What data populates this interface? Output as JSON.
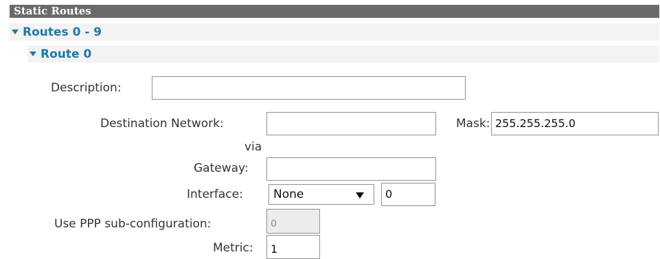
{
  "section": {
    "title": "Static Routes"
  },
  "routes_group": {
    "label": "Routes 0 - 9"
  },
  "route": {
    "label": "Route 0",
    "description": {
      "label": "Description:",
      "value": ""
    },
    "destination": {
      "label": "Destination Network:",
      "value": ""
    },
    "mask": {
      "label": "Mask:",
      "value": "255.255.255.0"
    },
    "via": "via",
    "gateway": {
      "label": "Gateway:",
      "value": ""
    },
    "interface": {
      "label": "Interface:",
      "selected": "None",
      "index": "0"
    },
    "ppp": {
      "label": "Use PPP sub-configuration:",
      "value": "0"
    },
    "metric": {
      "label": "Metric:",
      "value": "1"
    }
  }
}
